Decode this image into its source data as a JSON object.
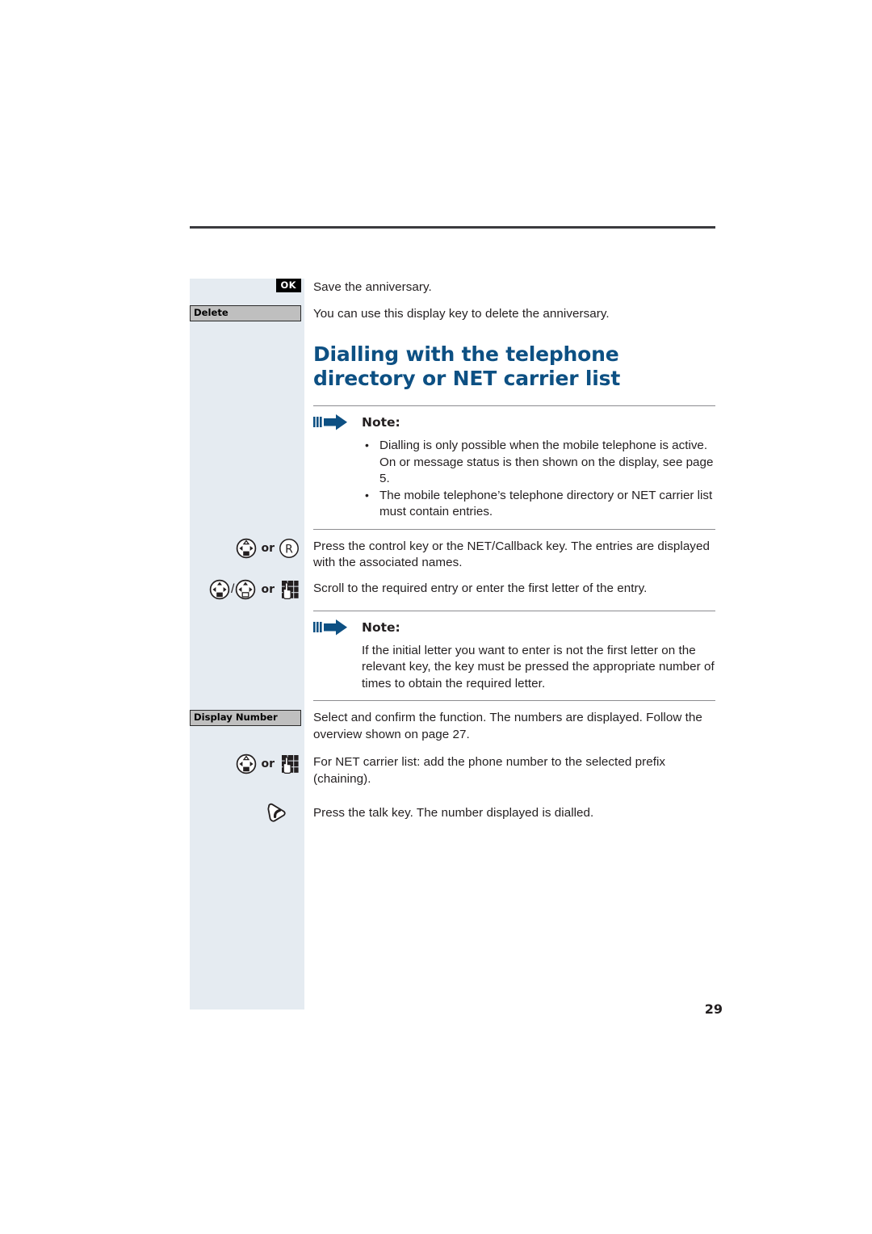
{
  "document": {
    "page_number": "29",
    "heading": "Dialling with the telephone directory or NET carrier list"
  },
  "colors": {
    "heading_blue": "#0d5083",
    "arrow_blue": "#0d5083",
    "margin_panel": "#e5ebf1",
    "softkey_fill": "#bfbfbf",
    "rule": "#8c8c90",
    "text": "#231f20"
  },
  "rows": [
    {
      "id": "save-anniversary",
      "gutter": {
        "type": "key-ok",
        "label": "OK"
      },
      "text": "Save the anniversary."
    },
    {
      "id": "delete-anniversary",
      "gutter": {
        "type": "softkey",
        "label": "Delete"
      },
      "text": "You can use this display key to delete the anniversary."
    },
    {
      "id": "control-or-net-callback",
      "gutter": {
        "type": "icons",
        "or_label": "or"
      },
      "text": "Press the control key or the NET/Callback key. The entries are displayed with the associated names."
    },
    {
      "id": "scroll-or-enter-letter",
      "gutter": {
        "type": "icons",
        "or_label": "or",
        "slash": "/"
      },
      "text": "Scroll to the required entry or enter the first letter of the entry."
    },
    {
      "id": "display-number",
      "gutter": {
        "type": "softkey",
        "label": "Display Number"
      },
      "text": "Select and confirm the function. The numbers are displayed. Follow the overview shown on page 27."
    },
    {
      "id": "net-carrier-chaining",
      "gutter": {
        "type": "icons",
        "or_label": "or"
      },
      "text": "For NET carrier list: add the phone number to the selected prefix (chaining)."
    },
    {
      "id": "talk-key",
      "gutter": {
        "type": "icons"
      },
      "text": "Press the talk key. The number displayed is dialled."
    }
  ],
  "notes": [
    {
      "id": "note-dialling-prerequisites",
      "title": "Note:",
      "bullets": [
        "Dialling is only possible when the mobile telephone is active. On or message status is then shown on the display, see page 5.",
        "The mobile telephone’s telephone directory or NET carrier list must contain entries."
      ]
    },
    {
      "id": "note-initial-letter",
      "title": "Note:",
      "paragraph": "If the initial letter you want to enter is not the first letter on the relevant key, the key must be pressed the appropriate number of times to obtain the required letter."
    }
  ],
  "icons": {
    "control_key": "control-key-icon",
    "net_callback_key": "net-callback-r-key-icon",
    "keypad": "keypad-hand-icon",
    "talk_key": "talk-key-icon",
    "note_arrow": "note-arrow-icon"
  }
}
